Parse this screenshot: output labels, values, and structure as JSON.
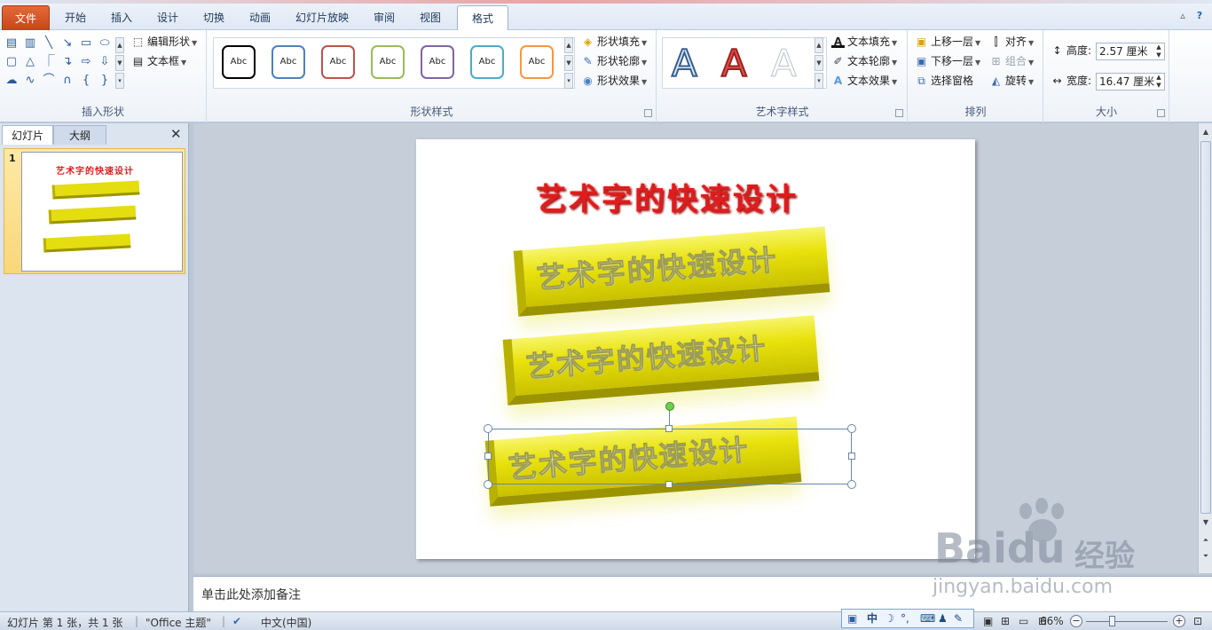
{
  "tabs": {
    "file": "文件",
    "home": "开始",
    "insert": "插入",
    "design": "设计",
    "transitions": "切换",
    "animations": "动画",
    "slideshow": "幻灯片放映",
    "review": "审阅",
    "view": "视图",
    "format": "格式"
  },
  "ribbon": {
    "insert_shapes": {
      "label": "插入形状",
      "edit_shape": "编辑形状",
      "text_box": "文本框"
    },
    "shape_styles": {
      "label": "形状样式",
      "preset_text": "Abc",
      "preset_colors": [
        "#000000",
        "#4f81bd",
        "#c0504d",
        "#9bbb59",
        "#8064a2",
        "#4bacc6",
        "#f79646"
      ],
      "shape_fill": "形状填充",
      "shape_outline": "形状轮廓",
      "shape_effects": "形状效果"
    },
    "wordart_styles": {
      "label": "艺术字样式",
      "sample": "A",
      "text_fill": "文本填充",
      "text_outline": "文本轮廓",
      "text_effects": "文本效果"
    },
    "arrange": {
      "label": "排列",
      "bring_forward": "上移一层",
      "send_backward": "下移一层",
      "selection_pane": "选择窗格",
      "align": "对齐",
      "group": "组合",
      "rotate": "旋转"
    },
    "size": {
      "label": "大小",
      "height_label": "高度:",
      "height_value": "2.57 厘米",
      "width_label": "宽度:",
      "width_value": "16.47 厘米"
    }
  },
  "left_pane": {
    "tab_slides": "幻灯片",
    "tab_outline": "大纲",
    "slide_number": "1"
  },
  "slide": {
    "title": "艺术字的快速设计",
    "wordart_lines": [
      "艺术字的快速设计",
      "艺术字的快速设计",
      "艺术字的快速设计"
    ]
  },
  "notes": {
    "placeholder": "单击此处添加备注"
  },
  "status": {
    "slide_info": "幻灯片 第 1 张，共 1 张",
    "theme": "\"Office 主题\"",
    "language": "中文(中国)",
    "zoom": "66%",
    "ime_mode": "中"
  },
  "watermark": {
    "brand": "Baidu",
    "product": "经验",
    "url": "jingyan.baidu.com"
  }
}
